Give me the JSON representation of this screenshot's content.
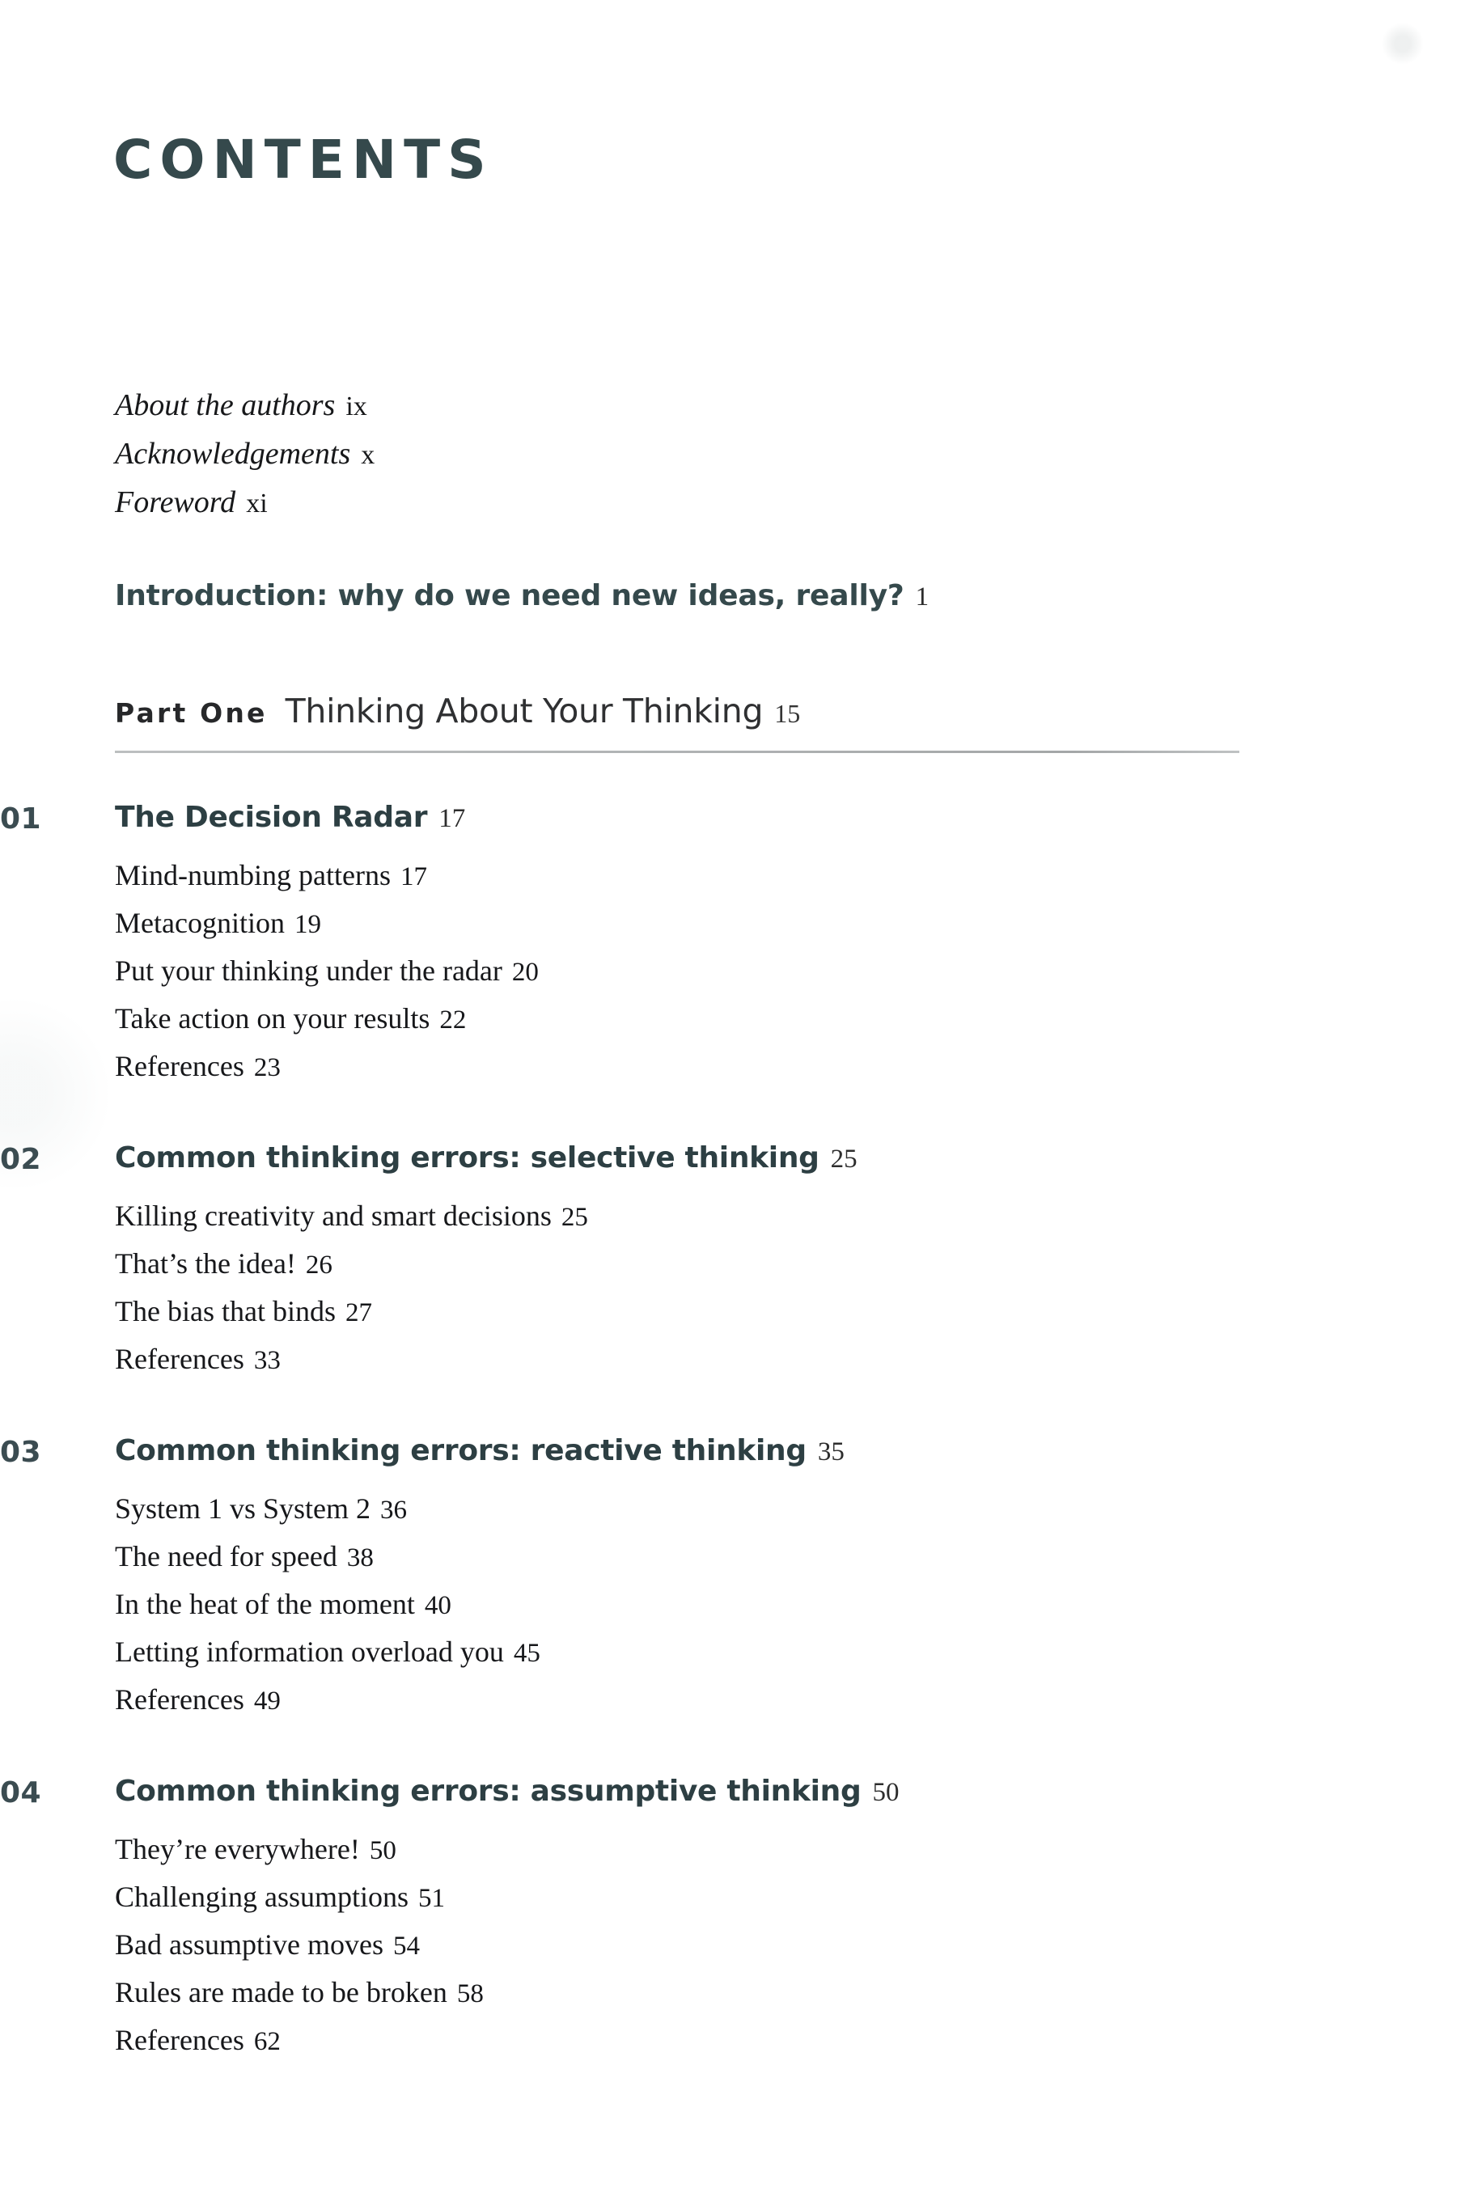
{
  "page": {
    "title": "CONTENTS",
    "accent_color": "#35494c",
    "body_color": "#16171a",
    "background_color": "#ffffff",
    "rule_color": "#a9acad"
  },
  "frontmatter": [
    {
      "title": "About the authors",
      "page": "ix"
    },
    {
      "title": "Acknowledgements",
      "page": "x"
    },
    {
      "title": "Foreword",
      "page": "xi"
    }
  ],
  "introduction": {
    "title": "Introduction: why do we need new ideas, really?",
    "page": "1"
  },
  "part": {
    "label": "Part One",
    "title": "Thinking About Your Thinking",
    "page": "15"
  },
  "chapters": [
    {
      "number": "01",
      "title": "The Decision Radar",
      "page": "17",
      "sections": [
        {
          "title": "Mind-numbing patterns",
          "page": "17"
        },
        {
          "title": "Metacognition",
          "page": "19"
        },
        {
          "title": "Put your thinking under the radar",
          "page": "20"
        },
        {
          "title": "Take action on your results",
          "page": "22"
        },
        {
          "title": "References",
          "page": "23"
        }
      ]
    },
    {
      "number": "02",
      "title": "Common thinking errors: selective thinking",
      "page": "25",
      "sections": [
        {
          "title": "Killing creativity and smart decisions",
          "page": "25"
        },
        {
          "title": "That’s the idea!",
          "page": "26"
        },
        {
          "title": "The bias that binds",
          "page": "27"
        },
        {
          "title": "References",
          "page": "33"
        }
      ]
    },
    {
      "number": "03",
      "title": "Common thinking errors: reactive thinking",
      "page": "35",
      "sections": [
        {
          "title": "System 1 vs System 2",
          "page": "36"
        },
        {
          "title": "The need for speed",
          "page": "38"
        },
        {
          "title": "In the heat of the moment",
          "page": "40"
        },
        {
          "title": "Letting information overload you",
          "page": "45"
        },
        {
          "title": "References",
          "page": "49"
        }
      ]
    },
    {
      "number": "04",
      "title": "Common thinking errors: assumptive thinking",
      "page": "50",
      "sections": [
        {
          "title": "They’re everywhere!",
          "page": "50"
        },
        {
          "title": "Challenging assumptions",
          "page": "51"
        },
        {
          "title": "Bad assumptive moves",
          "page": "54"
        },
        {
          "title": "Rules are made to be broken",
          "page": "58"
        },
        {
          "title": "References",
          "page": "62"
        }
      ]
    }
  ]
}
